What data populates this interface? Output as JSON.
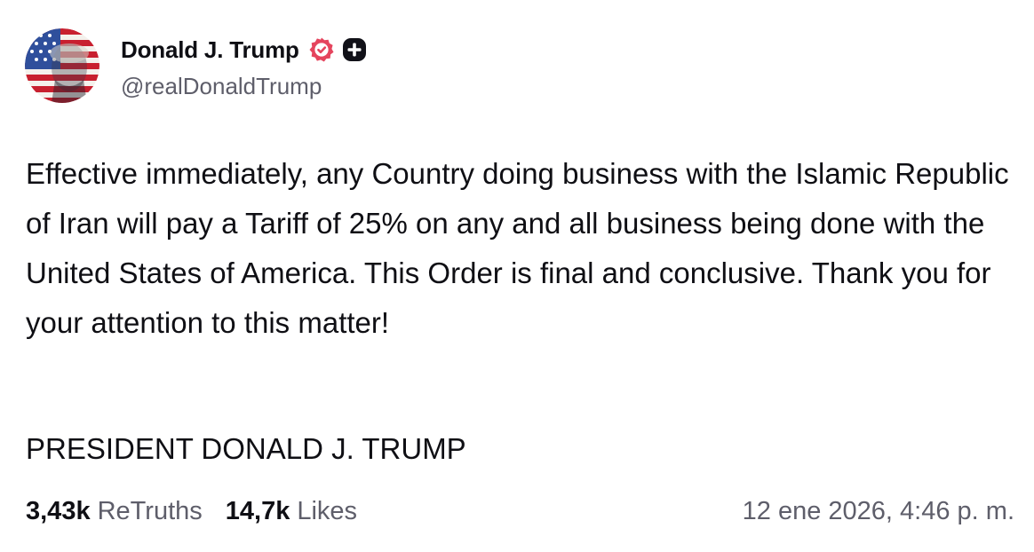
{
  "author": {
    "display_name": "Donald J. Trump",
    "handle": "@realDonaldTrump",
    "verified_badge_color": "#e5445d",
    "avatar_icon": "flag-portrait-avatar"
  },
  "post": {
    "content": "Effective immediately, any Country doing business with the Islamic Republic of Iran will pay a Tariff of 25% on any and all business being done with the United States of America. This Order is final and conclusive. Thank you for your attention to this matter!",
    "signature": "PRESIDENT DONALD J. TRUMP"
  },
  "stats": {
    "retruths_count": "3,43k",
    "retruths_label": "ReTruths",
    "likes_count": "14,7k",
    "likes_label": "Likes"
  },
  "timestamp": "12 ene 2026, 4:46 p. m.",
  "colors": {
    "text_primary": "#0f0f14",
    "text_secondary": "#5e5e6a",
    "background": "#ffffff"
  }
}
